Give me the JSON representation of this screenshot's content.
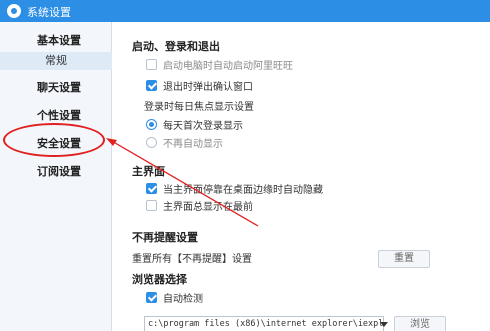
{
  "window": {
    "title": "系统设置"
  },
  "sidebar": {
    "items": [
      {
        "label": "基本设置"
      },
      {
        "label": "常规"
      },
      {
        "label": "聊天设置"
      },
      {
        "label": "个性设置"
      },
      {
        "label": "安全设置"
      },
      {
        "label": "订阅设置"
      }
    ]
  },
  "startup": {
    "title": "启动、登录和退出",
    "auto_start": {
      "label": "启动电脑时自动启动阿里旺旺",
      "checked": false
    },
    "exit_confirm": {
      "label": "退出时弹出确认窗口",
      "checked": true
    },
    "focus_label": "登录时每日焦点显示设置",
    "focus_first": {
      "label": "每天首次登录显示",
      "selected": true
    },
    "focus_never": {
      "label": "不再自动显示",
      "selected": false
    }
  },
  "main_ui": {
    "title": "主界面",
    "auto_hide": {
      "label": "当主界面停靠在桌面边缘时自动隐藏",
      "checked": true
    },
    "always_top": {
      "label": "主界面总显示在最前",
      "checked": false
    }
  },
  "no_remind": {
    "title": "不再提醒设置",
    "desc": "重置所有【不再提醒】设置",
    "reset_button": "重置"
  },
  "browser": {
    "title": "浏览器选择",
    "auto_detect": {
      "label": "自动检测",
      "checked": true
    },
    "path_value": "c:\\program files (x86)\\internet explorer\\iexpl",
    "browse_button": "浏览"
  },
  "colors": {
    "accent": "#2d8ee6",
    "annotation": "#e12020"
  }
}
